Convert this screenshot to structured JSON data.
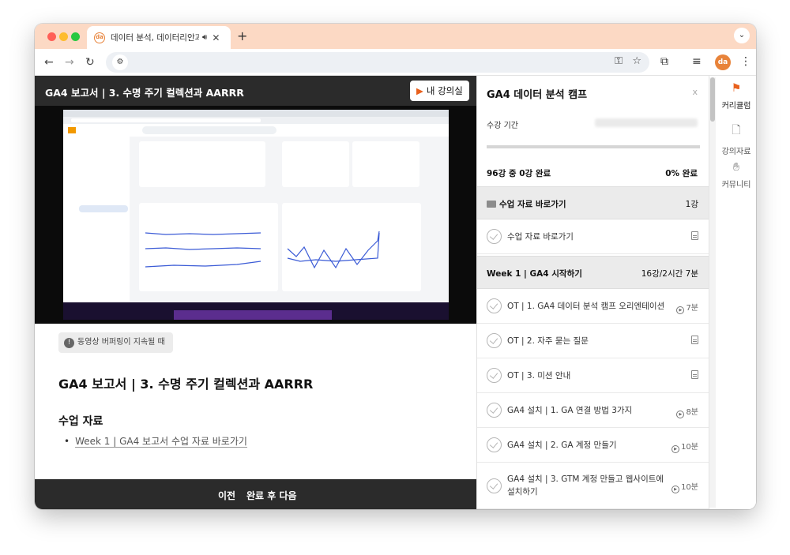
{
  "browser": {
    "tab_title": "데이터 분석, 데이터리안과 시작하기",
    "tab_favicon_text": "da",
    "new_tab_label": "+",
    "tab_menu_label": "⌄",
    "url": ""
  },
  "header": {
    "lesson_title": "GA4 보고서 | 3. 수명 주기 컬렉션과 AARRR",
    "my_class_button": "내 강의실"
  },
  "video": {
    "buffering_note": "동영상 버퍼링이 지속될 때"
  },
  "body": {
    "title": "GA4 보고서 | 3. 수명 주기 컬렉션과 AARRR",
    "materials_heading": "수업 자료",
    "materials": [
      "Week 1 | GA4 보고서 수업 자료 바로가기"
    ]
  },
  "footer": {
    "prev_label": "이전",
    "next_label": "완료 후 다음"
  },
  "curriculum": {
    "title": "GA4 데이터 분석 캠프",
    "close_label": "x",
    "period_label": "수강 기간",
    "progress_fraction": 0,
    "completion_text": "96강 중 0강 완료",
    "completion_pct": "0% 완료",
    "sections": [
      {
        "name": "수업 자료 바로가기",
        "meta": "1강",
        "lessons": [
          {
            "name": "수업 자료 바로가기",
            "type": "doc",
            "duration": ""
          }
        ]
      },
      {
        "name": "Week 1 | GA4 시작하기",
        "meta": "16강/2시간 7분",
        "lessons": [
          {
            "name": "OT | 1. GA4 데이터 분석 캠프 오리엔테이션",
            "type": "video",
            "duration": "7분"
          },
          {
            "name": "OT | 2. 자주 묻는 질문",
            "type": "doc",
            "duration": ""
          },
          {
            "name": "OT | 3. 미션 안내",
            "type": "doc",
            "duration": ""
          },
          {
            "name": "GA4 설치 | 1. GA 연결 방법 3가지",
            "type": "video",
            "duration": "8분"
          },
          {
            "name": "GA4 설치 | 2. GA 계정 만들기",
            "type": "video",
            "duration": "10분"
          },
          {
            "name": "GA4 설치 | 3. GTM 계정 만들고 웹사이트에",
            "name_line2": "설치하기",
            "type": "video",
            "duration": "10분"
          }
        ]
      }
    ]
  },
  "rail": {
    "items": [
      {
        "label": "커리큘럼",
        "icon": "flag-icon"
      },
      {
        "label": "강의자료",
        "icon": "file-add-icon"
      },
      {
        "label": "커뮤니티",
        "icon": "community-icon"
      }
    ]
  },
  "colors": {
    "accent": "#e8601c",
    "tabstrip": "#fcd9c4",
    "dark_bar": "#2b2b2b"
  }
}
